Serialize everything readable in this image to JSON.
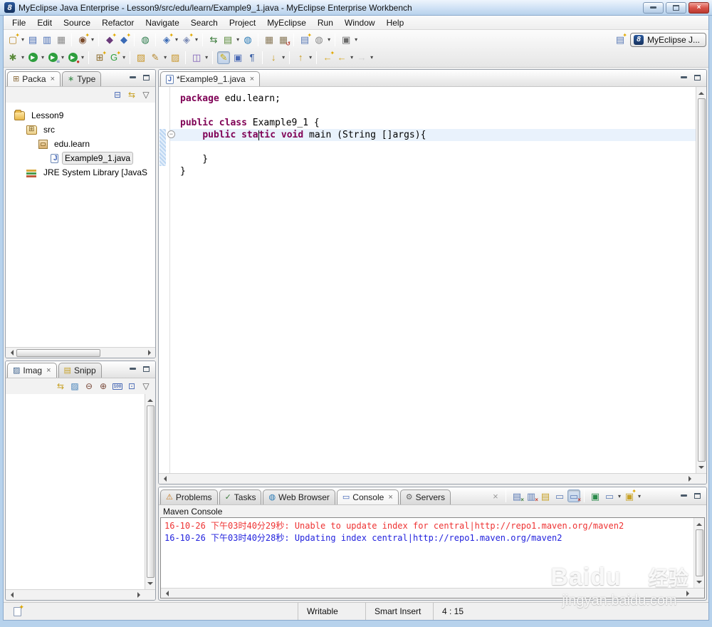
{
  "colors": {
    "keyword": "#7f0055",
    "console_error": "#ee3333",
    "console_info": "#2222dd",
    "current_line": "#e9f2fc",
    "titlebar_logo_bg": "#16325e"
  },
  "window": {
    "title": "MyEclipse Java Enterprise - Lesson9/src/edu/learn/Example9_1.java - MyEclipse Enterprise Workbench",
    "logo_glyph": "8"
  },
  "menu": {
    "items": [
      "File",
      "Edit",
      "Source",
      "Refactor",
      "Navigate",
      "Search",
      "Project",
      "MyEclipse",
      "Run",
      "Window",
      "Help"
    ]
  },
  "toolbar": {
    "rows": [
      {
        "groups": [
          {
            "items": [
              {
                "name": "new-wizard-icon",
                "glyph": "▢",
                "color": "#b5862a",
                "star": true,
                "dd": true
              },
              {
                "name": "save-icon",
                "glyph": "▤",
                "color": "#4a6fb5"
              },
              {
                "name": "save-all-icon",
                "glyph": "▥",
                "color": "#4a6fb5"
              },
              {
                "name": "print-icon",
                "glyph": "▦",
                "color": "#8a8a8a"
              }
            ]
          },
          {
            "items": [
              {
                "name": "new-java-project-icon",
                "glyph": "◉",
                "color": "#7a4a2a",
                "star": true,
                "dd": true
              }
            ]
          },
          {
            "items": [
              {
                "name": "new-java-package-icon",
                "glyph": "◆",
                "color": "#6a3a7a",
                "star": true
              },
              {
                "name": "new-java-class-icon",
                "glyph": "◆",
                "color": "#3a6ab5",
                "star": true
              }
            ]
          },
          {
            "items": [
              {
                "name": "new-report-icon",
                "glyph": "◍",
                "color": "#2a7a4a"
              }
            ]
          },
          {
            "items": [
              {
                "name": "new-web-project-icon",
                "glyph": "◈",
                "color": "#3a6ab5",
                "star": true,
                "dd": true
              },
              {
                "name": "new-jsp-icon",
                "glyph": "◈",
                "color": "#7a8ab5",
                "star": true,
                "dd": true
              }
            ]
          },
          {
            "items": [
              {
                "name": "synchronize-icon",
                "glyph": "⇆",
                "color": "#3a7a3a"
              },
              {
                "name": "checkout-icon",
                "glyph": "▤",
                "color": "#5a8a3a",
                "dd": true
              },
              {
                "name": "web-browser-icon",
                "glyph": "◍",
                "color": "#2a7ab5"
              }
            ]
          },
          {
            "items": [
              {
                "name": "deploy-icon",
                "glyph": "▦",
                "color": "#8a7a5a"
              },
              {
                "name": "undeploy-icon",
                "glyph": "▦",
                "color": "#8a7a5a",
                "badge": "↺",
                "badgeColor": "#b53a2a"
              }
            ]
          },
          {
            "items": [
              {
                "name": "new-server-icon",
                "glyph": "▤",
                "color": "#5a7ab5",
                "star": true
              },
              {
                "name": "internet-settings-icon",
                "glyph": "◍",
                "color": "#8a8a8a",
                "dd": true
              }
            ]
          },
          {
            "items": [
              {
                "name": "screenshot-icon",
                "glyph": "▣",
                "color": "#6a6a6a",
                "dd": true
              }
            ]
          }
        ]
      },
      {
        "groups": [
          {
            "items": [
              {
                "name": "debug-icon",
                "glyph": "✱",
                "color": "#5a8a3a",
                "dd": true
              },
              {
                "name": "run-icon",
                "glyph": "▶",
                "bg": "#2e9e3e",
                "circle": true,
                "dd": true
              },
              {
                "name": "run-last-icon",
                "glyph": "▶",
                "bg": "#2e9e3e",
                "circle": true,
                "badge": "≡",
                "badgeColor": "#4a6fb5",
                "dd": true
              },
              {
                "name": "profile-icon",
                "glyph": "▶",
                "bg": "#2e9e3e",
                "circle": true,
                "badge": "●",
                "badgeColor": "#c0392b",
                "dd": true
              }
            ]
          },
          {
            "items": [
              {
                "name": "open-type-icon",
                "glyph": "⊞",
                "color": "#8a6a2a",
                "star": true
              },
              {
                "name": "generate-icon",
                "glyph": "G",
                "color": "#2e9e3e",
                "star": true,
                "dd": true
              }
            ]
          },
          {
            "items": [
              {
                "name": "open-resource-icon",
                "glyph": "▨",
                "color": "#c8962a"
              },
              {
                "name": "search-icon",
                "glyph": "✎",
                "color": "#b5862a",
                "dd": true
              },
              {
                "name": "open-folder-icon",
                "glyph": "▨",
                "color": "#c8962a"
              }
            ]
          },
          {
            "items": [
              {
                "name": "external-tools-icon",
                "glyph": "◫",
                "color": "#7a5ab5",
                "dd": true
              }
            ]
          },
          {
            "items": [
              {
                "name": "highlight-marker-icon",
                "glyph": "✎",
                "color": "#c8a800",
                "pressed": true
              },
              {
                "name": "show-selected-element-icon",
                "glyph": "▣",
                "color": "#4a6ab5"
              },
              {
                "name": "show-whitespace-icon",
                "glyph": "¶",
                "color": "#3a5fa5"
              }
            ]
          },
          {
            "items": [
              {
                "name": "sort-members-icon",
                "glyph": "↓",
                "color": "#c89a1a",
                "dd": true
              }
            ]
          },
          {
            "items": [
              {
                "name": "next-annotation-icon",
                "glyph": "↑",
                "color": "#c89a1a",
                "dd": true
              }
            ]
          },
          {
            "items": [
              {
                "name": "last-edit-location-icon",
                "glyph": "←",
                "color": "#d8a820",
                "star": true
              },
              {
                "name": "back-icon",
                "glyph": "←",
                "color": "#d8a820",
                "dd": true
              },
              {
                "name": "forward-icon",
                "glyph": "→",
                "color": "#b0b0b0",
                "disabled": true,
                "dd": true
              }
            ]
          }
        ]
      }
    ],
    "perspective": {
      "open_icon_name": "open-perspective-icon",
      "button_label": "MyEclipse J...",
      "logo_glyph": "8"
    }
  },
  "views": {
    "package_explorer": {
      "tabs": [
        {
          "label": "Packa",
          "active": true,
          "close": true,
          "icon": "package-explorer-icon",
          "glyph": "⊞",
          "color": "#8a6a3a"
        },
        {
          "label": "Type",
          "icon": "type-hierarchy-icon",
          "glyph": "∗",
          "color": "#3a8a4a"
        }
      ],
      "toolbar": [
        {
          "name": "collapse-all-icon",
          "glyph": "⊟",
          "color": "#4a6ab5"
        },
        {
          "name": "link-with-editor-icon",
          "glyph": "⇆",
          "color": "#c8a228"
        },
        {
          "name": "view-menu-icon",
          "glyph": "▽",
          "color": "#555555"
        }
      ],
      "tree": [
        {
          "label": "Lesson9",
          "level": 0,
          "icon": "project-icon"
        },
        {
          "label": "src",
          "level": 1,
          "icon": "source-folder-icon"
        },
        {
          "label": "edu.learn",
          "level": 2,
          "icon": "package-icon"
        },
        {
          "label": "Example9_1.java",
          "level": 3,
          "icon": "java-file-icon",
          "selected": true
        },
        {
          "label": "JRE System Library [JavaS",
          "level": 1,
          "icon": "library-icon"
        }
      ]
    },
    "image_view": {
      "tabs": [
        {
          "label": "Imag",
          "active": true,
          "close": true,
          "icon": "image-icon",
          "glyph": "▨",
          "color": "#3a5f8a"
        },
        {
          "label": "Snipp",
          "icon": "snippets-icon",
          "glyph": "▤",
          "color": "#c8a228"
        }
      ],
      "toolbar": [
        {
          "name": "link-with-editor-icon",
          "glyph": "⇆",
          "color": "#c8a228"
        },
        {
          "name": "export-image-icon",
          "glyph": "▨",
          "color": "#3a7ab5"
        },
        {
          "name": "zoom-out-icon",
          "glyph": "⊖",
          "color": "#7a4a3a"
        },
        {
          "name": "zoom-in-icon",
          "glyph": "⊕",
          "color": "#7a4a3a"
        },
        {
          "name": "actual-size-icon",
          "label": "100",
          "color": "#4a6ab5"
        },
        {
          "name": "fit-to-window-icon",
          "glyph": "⊡",
          "color": "#4a6ab5"
        },
        {
          "name": "view-menu-icon",
          "glyph": "▽",
          "color": "#555555"
        }
      ]
    },
    "editor": {
      "tabs": [
        {
          "label": "*Example9_1.java",
          "active": true,
          "close": true,
          "icon": "java-file-icon",
          "glyph": "J",
          "color": "#3a5fb5"
        }
      ],
      "code_lines": [
        {
          "tokens": [
            {
              "t": "package",
              "kw": true
            },
            {
              "t": " edu.learn;"
            }
          ]
        },
        {
          "tokens": []
        },
        {
          "tokens": [
            {
              "t": "public",
              "kw": true
            },
            {
              "t": " "
            },
            {
              "t": "class",
              "kw": true
            },
            {
              "t": " Example9_1 {"
            }
          ]
        },
        {
          "highlight": true,
          "fold": true,
          "tokens": [
            {
              "t": "    "
            },
            {
              "t": "public",
              "kw": true
            },
            {
              "t": " "
            },
            {
              "t": "sta",
              "kw": true
            },
            {
              "caret": true
            },
            {
              "t": "tic",
              "kw": true
            },
            {
              "t": " "
            },
            {
              "t": "void",
              "kw": true
            },
            {
              "t": " main (String []args){"
            }
          ]
        },
        {
          "tokens": []
        },
        {
          "tokens": [
            {
              "t": "    }"
            }
          ]
        },
        {
          "tokens": [
            {
              "t": "}"
            }
          ]
        }
      ]
    },
    "console": {
      "tabs": [
        {
          "label": "Problems",
          "icon": "problems-icon",
          "glyph": "⚠",
          "color": "#c87a20"
        },
        {
          "label": "Tasks",
          "icon": "tasks-icon",
          "glyph": "✓",
          "color": "#3a7a3a"
        },
        {
          "label": "Web Browser",
          "icon": "web-browser-icon",
          "glyph": "◍",
          "color": "#2a7ab5"
        },
        {
          "label": "Console",
          "active": true,
          "close": true,
          "icon": "console-icon",
          "glyph": "▭",
          "color": "#3a5fb5"
        },
        {
          "label": "Servers",
          "icon": "servers-icon",
          "glyph": "⚙",
          "color": "#666666"
        }
      ],
      "toolbar": [
        {
          "items": [
            {
              "name": "clear-console-icon",
              "glyph": "×",
              "color": "#9a9a9a"
            }
          ]
        },
        {
          "items": [
            {
              "name": "remove-launch-icon",
              "glyph": "▤",
              "color": "#5a7ab5",
              "badge": "×",
              "badgeColor": "#3a7a3a"
            },
            {
              "name": "remove-all-launches-icon",
              "glyph": "▥",
              "color": "#5a7ab5",
              "badge": "×",
              "badgeColor": "#c0392b"
            },
            {
              "name": "scroll-lock-icon",
              "glyph": "▤",
              "color": "#c8a228"
            },
            {
              "name": "show-stdout-console-icon",
              "glyph": "▭",
              "color": "#5a7ab5"
            },
            {
              "name": "show-stderr-console-icon",
              "glyph": "▭",
              "color": "#5a7ab5",
              "badge": "×",
              "badgeColor": "#c0392b",
              "pressed": true
            }
          ]
        },
        {
          "items": [
            {
              "name": "pin-console-icon",
              "glyph": "▣",
              "color": "#2a8a4a"
            },
            {
              "name": "display-console-icon",
              "glyph": "▭",
              "color": "#5a7ab5",
              "dd": true
            },
            {
              "name": "open-console-icon",
              "glyph": "▣",
              "color": "#c8a228",
              "star": true,
              "dd": true
            }
          ]
        }
      ],
      "title": "Maven Console",
      "lines": [
        {
          "text": "16-10-26 下午03时40分29秒: Unable to update index for central|http://repo1.maven.org/maven2",
          "level": "error"
        },
        {
          "text": "16-10-26 下午03时40分28秒: Updating index central|http://repo1.maven.org/maven2",
          "level": "info"
        }
      ]
    }
  },
  "status_bar": {
    "cells": [
      "Writable",
      "Smart Insert",
      "4 : 15"
    ]
  },
  "watermark": {
    "brand": "Baidu",
    "suffix": "经验",
    "domain": "jingyan.baidu.com"
  }
}
